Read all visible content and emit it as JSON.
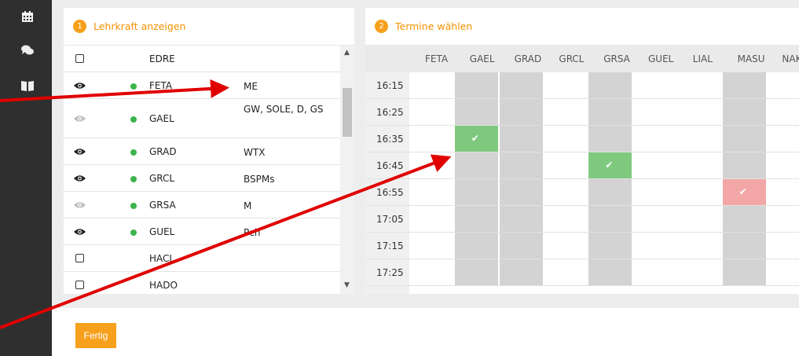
{
  "panel1": {
    "step": "1",
    "title": "Lehrkraft anzeigen"
  },
  "panel2": {
    "step": "2",
    "title": "Termine wählen"
  },
  "teachers": [
    {
      "state": "checkbox",
      "code": "EDRE",
      "subjects": ""
    },
    {
      "state": "eye",
      "code": "FETA",
      "subjects": "ME"
    },
    {
      "state": "eye-faded",
      "code": "GAEL",
      "subjects": "GW, SOLE, D, GS"
    },
    {
      "state": "eye",
      "code": "GRAD",
      "subjects": "WTX"
    },
    {
      "state": "eye",
      "code": "GRCL",
      "subjects": "BSPMs"
    },
    {
      "state": "eye-faded",
      "code": "GRSA",
      "subjects": "M"
    },
    {
      "state": "eye",
      "code": "GUEL",
      "subjects": "Pch"
    },
    {
      "state": "checkbox",
      "code": "HACL",
      "subjects": ""
    },
    {
      "state": "checkbox",
      "code": "HADO",
      "subjects": ""
    }
  ],
  "columns": [
    "FETA",
    "GAEL",
    "GRAD",
    "GRCL",
    "GRSA",
    "GUEL",
    "LIAL",
    "MASU",
    "NAKL"
  ],
  "times": [
    "16:15",
    "16:25",
    "16:35",
    "16:45",
    "16:55",
    "17:05",
    "17:15",
    "17:25"
  ],
  "available_columns": [
    "GAEL",
    "GRAD",
    "GRSA",
    "MASU"
  ],
  "booked": [
    {
      "column": "GAEL",
      "time": "16:35",
      "status": "ok"
    },
    {
      "column": "GRSA",
      "time": "16:45",
      "status": "ok"
    },
    {
      "column": "MASU",
      "time": "16:55",
      "status": "conflict"
    }
  ],
  "done_button": "Fertig",
  "icons": {
    "sidebar": [
      "calendar-icon",
      "chat-icon",
      "book-icon"
    ]
  },
  "colors": {
    "accent": "#f7a01c",
    "ok": "#7fc97f",
    "conflict": "#f3a6a6",
    "online": "#3cb44b"
  }
}
